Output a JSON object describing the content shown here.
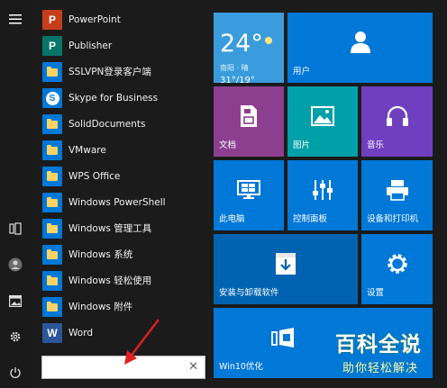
{
  "apps": [
    {
      "label": "PowerPoint",
      "icon": "powerpoint-icon",
      "color": "#c43e1c",
      "glyph": "P"
    },
    {
      "label": "Publisher",
      "icon": "publisher-icon",
      "color": "#077568",
      "glyph": "P"
    },
    {
      "label": "SSLVPN登录客户端",
      "icon": "folder-icon",
      "color": "#0078d7",
      "glyph": ""
    },
    {
      "label": "Skype for Business",
      "icon": "skype-icon",
      "color": "#0078d7",
      "glyph": "S"
    },
    {
      "label": "SolidDocuments",
      "icon": "folder-icon",
      "color": "#0078d7",
      "glyph": ""
    },
    {
      "label": "VMware",
      "icon": "folder-icon",
      "color": "#0078d7",
      "glyph": ""
    },
    {
      "label": "WPS Office",
      "icon": "folder-icon",
      "color": "#0078d7",
      "glyph": ""
    },
    {
      "label": "Windows PowerShell",
      "icon": "folder-icon",
      "color": "#0078d7",
      "glyph": ""
    },
    {
      "label": "Windows 管理工具",
      "icon": "folder-icon",
      "color": "#0078d7",
      "glyph": ""
    },
    {
      "label": "Windows 系统",
      "icon": "folder-icon",
      "color": "#0078d7",
      "glyph": ""
    },
    {
      "label": "Windows 轻松使用",
      "icon": "folder-icon",
      "color": "#0078d7",
      "glyph": ""
    },
    {
      "label": "Windows 附件",
      "icon": "folder-icon",
      "color": "#0078d7",
      "glyph": ""
    },
    {
      "label": "Word",
      "icon": "word-icon",
      "color": "#2b579a",
      "glyph": "W"
    }
  ],
  "rail": {
    "icons": [
      "hamburger-menu-icon",
      "tablet-icon",
      "user-account-icon",
      "photos-icon",
      "settings-gear-icon",
      "power-icon"
    ]
  },
  "search": {
    "value": "",
    "clear_glyph": "✕"
  },
  "weather": {
    "temp": "24°",
    "city": "南阳 · 晴",
    "range": "31°/19°",
    "color": "#3a9cdc"
  },
  "tiles": {
    "user": {
      "label": "用户",
      "icon": "user-icon",
      "color": "#0078d7"
    },
    "documents": {
      "label": "文档",
      "icon": "document-icon",
      "color": "#8d3f8f"
    },
    "pictures": {
      "label": "图片",
      "icon": "picture-icon",
      "color": "#00a0a8"
    },
    "music": {
      "label": "音乐",
      "icon": "headphones-icon",
      "color": "#6f3fc0"
    },
    "this_pc": {
      "label": "此电脑",
      "icon": "computer-icon",
      "color": "#0078d7"
    },
    "control_panel": {
      "label": "控制面板",
      "icon": "sliders-icon",
      "color": "#0078d7"
    },
    "devices_printers": {
      "label": "设备和打印机",
      "icon": "printer-icon",
      "color": "#0078d7"
    },
    "install_uninstall": {
      "label": "安装与卸载软件",
      "icon": "install-box-icon",
      "color": "#0063b1"
    },
    "settings": {
      "label": "设置",
      "icon": "gear-icon",
      "color": "#0078d7"
    },
    "win10_optimize": {
      "label": "Win10优化",
      "icon": "win10-optimize-icon",
      "color": "#0078d7"
    }
  },
  "watermark": {
    "title": "百科全说",
    "subtitle": "助你轻松解决"
  }
}
